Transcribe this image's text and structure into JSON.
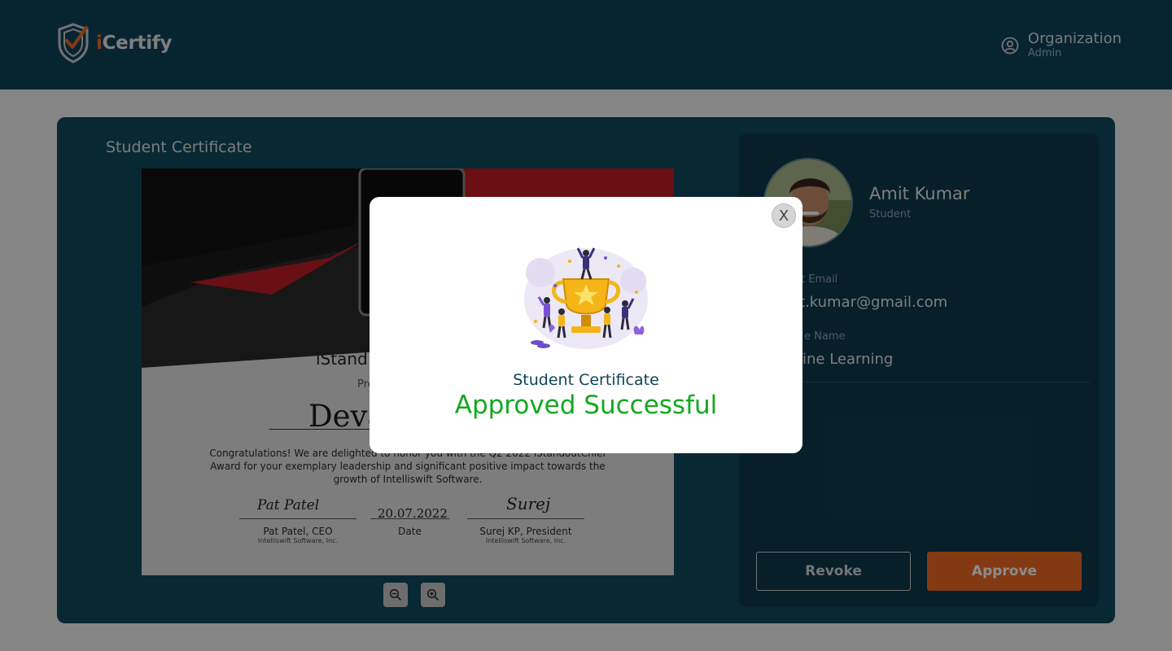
{
  "header": {
    "app_name_prefix": "i",
    "app_name_rest": "Certify",
    "user": {
      "name": "Organization",
      "role": "Admin"
    }
  },
  "main": {
    "title": "Student Certificate",
    "certificate": {
      "brand": "iStand",
      "presented_to": "Pre",
      "recipient": "Deva",
      "message": "Congratulations! We are delighted to honor you with the Q2 2022 iStandoutChief Award for your exemplary leadership and significant positive impact towards the growth of Intelliswift Software.",
      "signers": [
        {
          "mark": "Pat Patel",
          "name": "Pat Patel, CEO",
          "company": "Intelliswift Software, Inc."
        },
        {
          "mark": "20.07.2022",
          "name": "Date",
          "company": ""
        },
        {
          "mark": "Surej",
          "name": "Surej KP, President",
          "company": "Intelliswift Software, Inc."
        }
      ]
    },
    "zoom_controls": [
      "zoom-out",
      "zoom-in"
    ]
  },
  "student": {
    "name": "Amit Kumar",
    "role": "Student",
    "email_label": "t Email",
    "email_value": "t.kumar@gmail.com",
    "course_label": "e Name",
    "course_value": "ine Learning",
    "revoke_label": "Revoke",
    "approve_label": "Approve"
  },
  "modal": {
    "close_label": "X",
    "title": "Student Certificate",
    "status": "Approved Successful"
  },
  "colors": {
    "header_bg": "#0e4459",
    "card_bg": "#0f4a60",
    "accent": "#ee6b22",
    "success": "#13a81f"
  }
}
